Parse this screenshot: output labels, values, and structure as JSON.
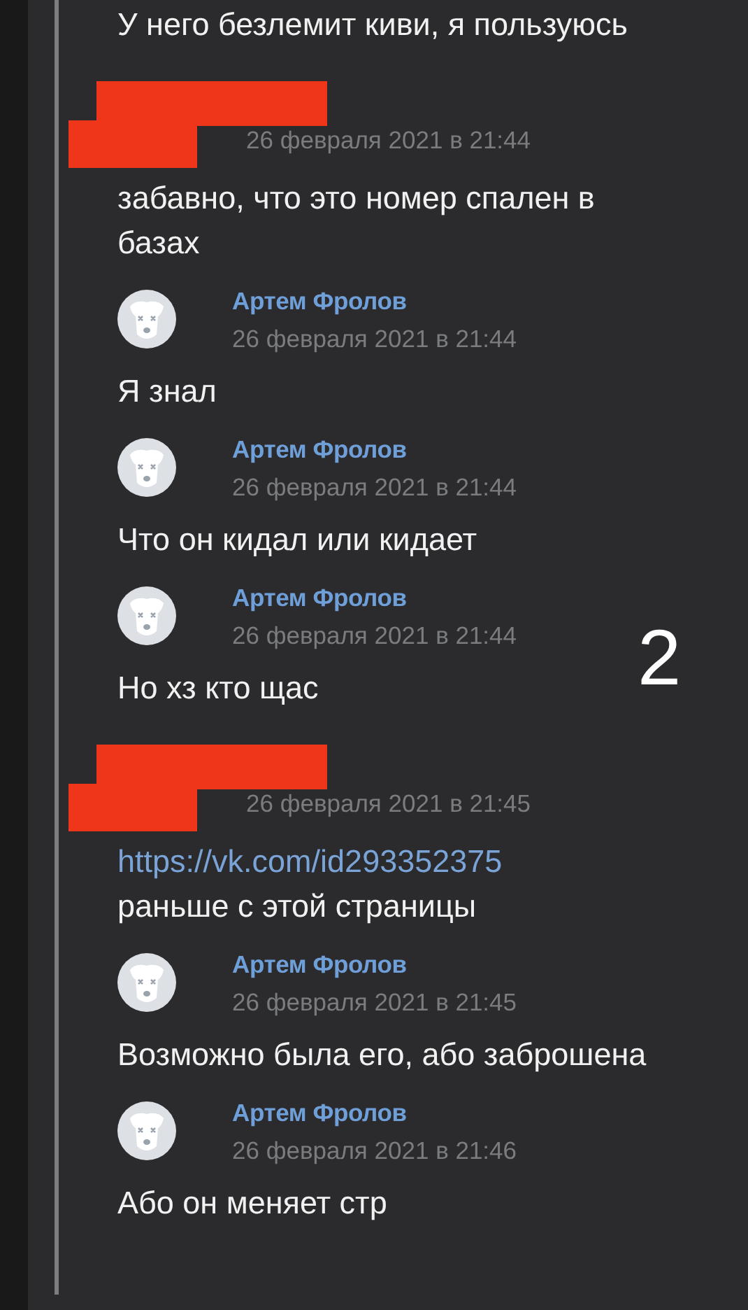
{
  "messages": [
    {
      "kind": "continuation",
      "lines": [
        {
          "kind": "text",
          "text": "У него безлемит киви, я пользуюсь"
        }
      ]
    },
    {
      "kind": "redacted",
      "date": "26 февраля 2021 в 21:44",
      "lines": [
        {
          "kind": "text",
          "text": "забавно, что это номер спален в базах"
        }
      ]
    },
    {
      "kind": "author",
      "author": "Артем Фролов",
      "date": "26 февраля 2021 в 21:44",
      "lines": [
        {
          "kind": "text",
          "text": "Я знал"
        }
      ]
    },
    {
      "kind": "author",
      "author": "Артем Фролов",
      "date": "26 февраля 2021 в 21:44",
      "lines": [
        {
          "kind": "text",
          "text": "Что он кидал или кидает"
        }
      ]
    },
    {
      "kind": "author",
      "author": "Артем Фролов",
      "date": "26 февраля 2021 в 21:44",
      "lines": [
        {
          "kind": "text",
          "text": "Но хз кто щас"
        }
      ]
    },
    {
      "kind": "redacted",
      "date": "26 февраля 2021 в 21:45",
      "lines": [
        {
          "kind": "link",
          "text": "https://vk.com/id293352375"
        },
        {
          "kind": "text",
          "text": "раньше с этой страницы"
        }
      ]
    },
    {
      "kind": "author",
      "author": "Артем Фролов",
      "date": "26 февраля 2021 в 21:45",
      "lines": [
        {
          "kind": "text",
          "text": "Возможно была его, або заброшена"
        }
      ]
    },
    {
      "kind": "author",
      "author": "Артем Фролов",
      "date": "26 февраля 2021 в 21:46",
      "lines": [
        {
          "kind": "text",
          "text": "Або он меняет стр"
        }
      ]
    }
  ],
  "annotation": "2"
}
